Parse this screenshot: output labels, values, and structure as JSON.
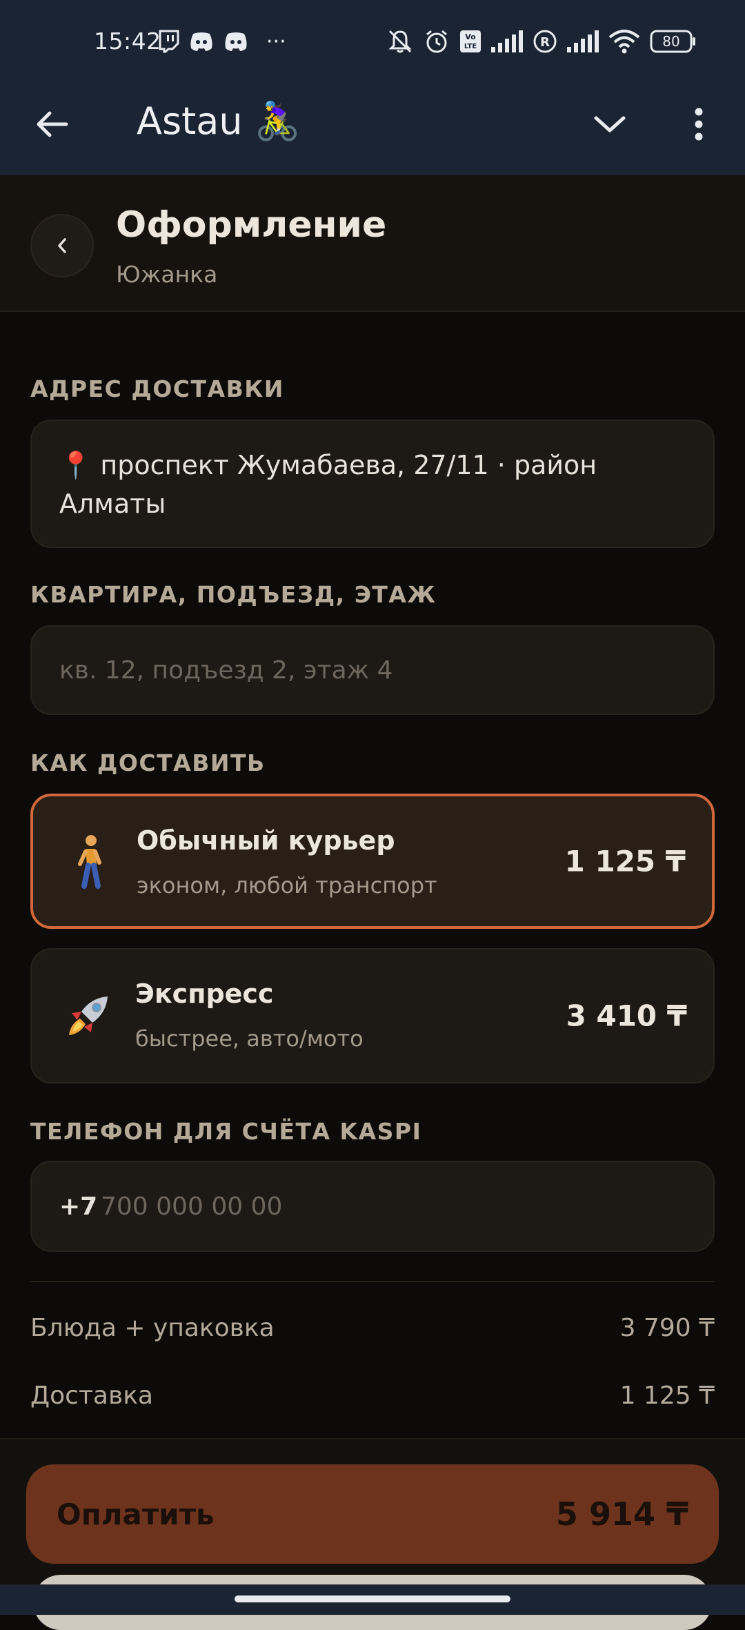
{
  "status_bar": {
    "time": "15:42",
    "left_icons": [
      "twitch-icon",
      "discord-icon",
      "discord-icon"
    ],
    "overflow": "···",
    "battery": "80",
    "volte": "Vo LTE"
  },
  "app_bar": {
    "title": "Astau 🚴‍♀️"
  },
  "header": {
    "title": "Оформление",
    "subtitle": "Южанка"
  },
  "address": {
    "label": "АДРЕС ДОСТАВКИ",
    "value": "📍 проспект Жумабаева, 27/11 · район Алматы"
  },
  "apartment": {
    "label": "КВАРТИРА, ПОДЪЕЗД, ЭТАЖ",
    "placeholder": "кв. 12, подъезд 2, этаж 4"
  },
  "delivery": {
    "label": "КАК ДОСТАВИТЬ",
    "options": [
      {
        "emoji": "🚶",
        "title": "Обычный курьер",
        "subtitle": "эконом, любой транспорт",
        "price": "1 125 ₸",
        "selected": true
      },
      {
        "emoji": "🚀",
        "title": "Экспресс",
        "subtitle": "быстрее, авто/мото",
        "price": "3 410 ₸",
        "selected": false
      }
    ]
  },
  "phone": {
    "label": "ТЕЛЕФОН ДЛЯ СЧЁТА KASPI",
    "prefix": "+7",
    "placeholder": "700 000 00 00"
  },
  "summary": {
    "items": [
      {
        "label": "Блюда + упаковка",
        "value": "3 790 ₸"
      },
      {
        "label": "Доставка",
        "value": "1 125 ₸"
      }
    ]
  },
  "pay_button": {
    "label": "Оплатить",
    "total": "5 914 ₸"
  },
  "colors": {
    "accent": "#d0683c",
    "pay_button": "#6e331d",
    "top_bar": "#1b2433",
    "background": "#0c0b09"
  }
}
